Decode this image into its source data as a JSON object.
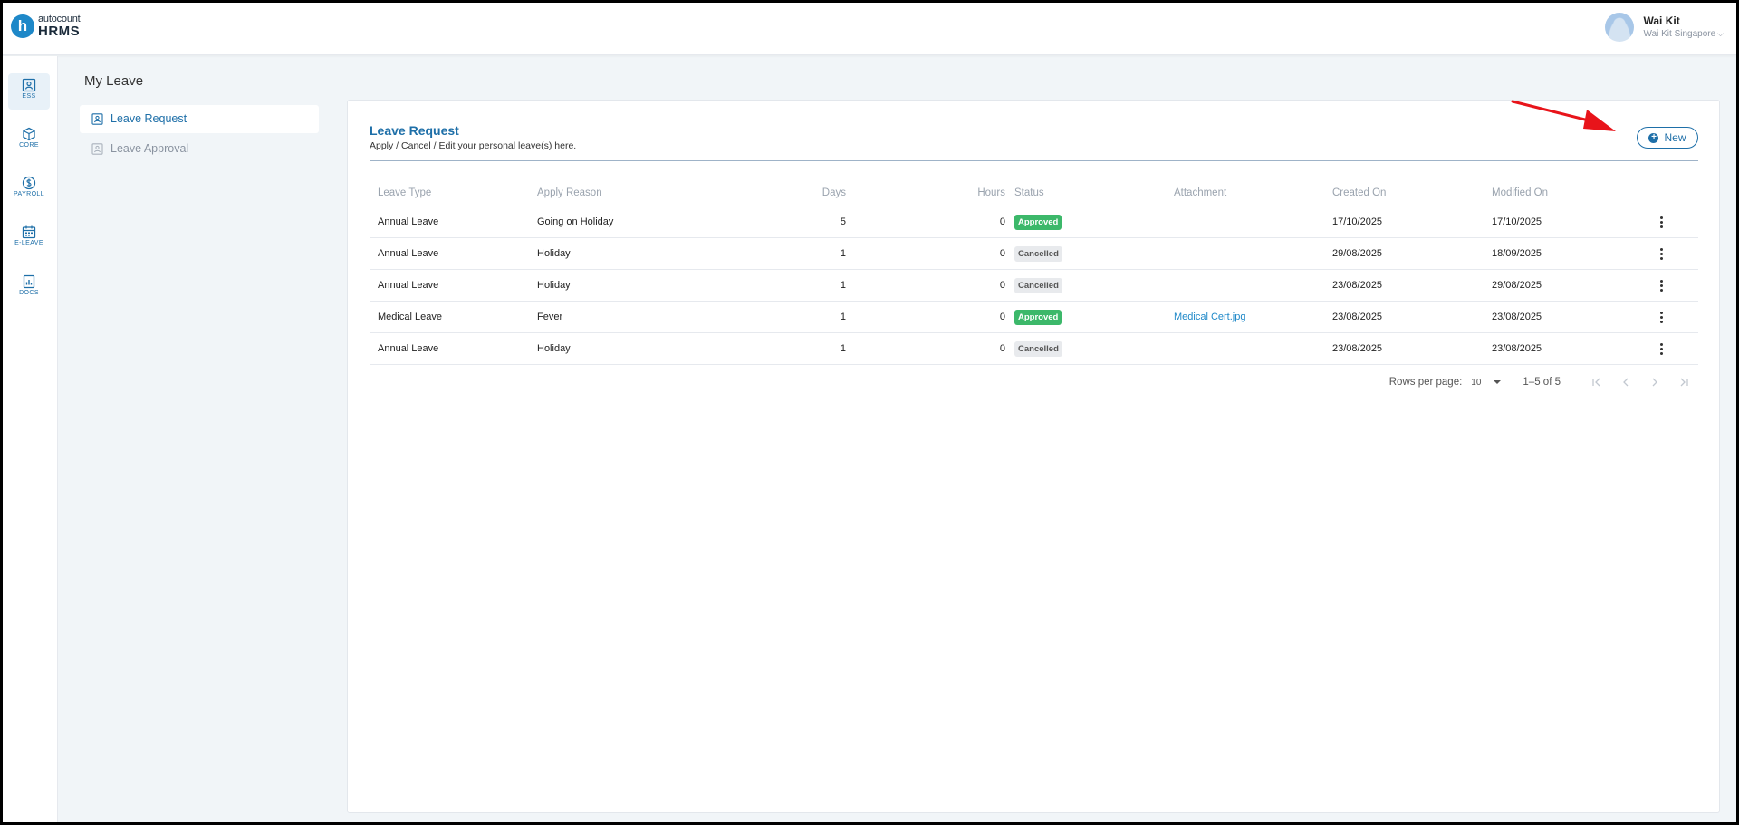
{
  "app": {
    "logo_small": "autocount",
    "logo_big": "HRMS",
    "logo_letter": "h"
  },
  "user": {
    "name": "Wai Kit",
    "company": "Wai Kit Singapore"
  },
  "rail": [
    {
      "label": "ESS",
      "icon": "ess-icon",
      "active": true
    },
    {
      "label": "CORE",
      "icon": "core-icon",
      "active": false
    },
    {
      "label": "PAYROLL",
      "icon": "payroll-icon",
      "active": false
    },
    {
      "label": "E-LEAVE",
      "icon": "calendar-icon",
      "active": false
    },
    {
      "label": "DOCS",
      "icon": "docs-icon",
      "active": false
    }
  ],
  "page": {
    "title": "My Leave"
  },
  "side_menu": [
    {
      "label": "Leave Request",
      "active": true
    },
    {
      "label": "Leave Approval",
      "active": false
    }
  ],
  "card": {
    "title": "Leave Request",
    "subtitle": "Apply / Cancel / Edit your personal leave(s) here.",
    "new_label": "New"
  },
  "table": {
    "headers": {
      "type": "Leave Type",
      "reason": "Apply Reason",
      "days": "Days",
      "hours": "Hours",
      "status": "Status",
      "attach": "Attachment",
      "created": "Created On",
      "modified": "Modified On"
    },
    "rows": [
      {
        "type": "Annual Leave",
        "reason": "Going on Holiday",
        "days": "5",
        "hours": "0",
        "status": "Approved",
        "attach": "",
        "created": "17/10/2025",
        "modified": "17/10/2025"
      },
      {
        "type": "Annual Leave",
        "reason": "Holiday",
        "days": "1",
        "hours": "0",
        "status": "Cancelled",
        "attach": "",
        "created": "29/08/2025",
        "modified": "18/09/2025"
      },
      {
        "type": "Annual Leave",
        "reason": "Holiday",
        "days": "1",
        "hours": "0",
        "status": "Cancelled",
        "attach": "",
        "created": "23/08/2025",
        "modified": "29/08/2025"
      },
      {
        "type": "Medical Leave",
        "reason": "Fever",
        "days": "1",
        "hours": "0",
        "status": "Approved",
        "attach": "Medical Cert.jpg",
        "created": "23/08/2025",
        "modified": "23/08/2025"
      },
      {
        "type": "Annual Leave",
        "reason": "Holiday",
        "days": "1",
        "hours": "0",
        "status": "Cancelled",
        "attach": "",
        "created": "23/08/2025",
        "modified": "23/08/2025"
      }
    ]
  },
  "pager": {
    "rows_per_page_label": "Rows per page:",
    "rows_per_page": "10",
    "range": "1–5 of 5"
  },
  "colors": {
    "accent": "#1e6fa8",
    "approved": "#3cb86a",
    "cancelled": "#e8eaed",
    "annotation_arrow": "#e8141a"
  }
}
